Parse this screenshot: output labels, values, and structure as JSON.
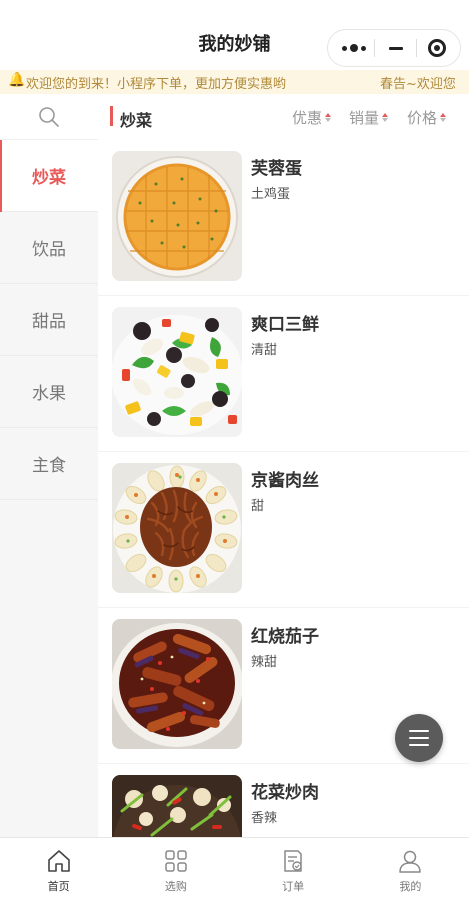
{
  "header": {
    "title": "我的妙铺"
  },
  "notice": {
    "text": "欢迎您的到来！小程序下单，更加方便实惠哟",
    "text2": "春告~欢迎您"
  },
  "sidebar": {
    "items": [
      {
        "label": "炒菜",
        "active": true
      },
      {
        "label": "饮品",
        "active": false
      },
      {
        "label": "甜品",
        "active": false
      },
      {
        "label": "水果",
        "active": false
      },
      {
        "label": "主食",
        "active": false
      }
    ]
  },
  "main": {
    "category": "炒菜",
    "sort": [
      "优惠",
      "销量",
      "价格"
    ],
    "dishes": [
      {
        "name": "芙蓉蛋",
        "desc": "土鸡蛋",
        "icon": "egg-custard-photo"
      },
      {
        "name": "爽口三鲜",
        "desc": "清甜",
        "icon": "stir-fry-vegetables-photo"
      },
      {
        "name": "京酱肉丝",
        "desc": "甜",
        "icon": "shredded-pork-photo"
      },
      {
        "name": "红烧茄子",
        "desc": "辣甜",
        "icon": "braised-eggplant-photo"
      },
      {
        "name": "花菜炒肉",
        "desc": "香辣",
        "icon": "cauliflower-pork-photo"
      }
    ]
  },
  "tabbar": {
    "items": [
      {
        "label": "首页",
        "icon": "home-icon",
        "active": true
      },
      {
        "label": "选购",
        "icon": "grid-icon",
        "active": false
      },
      {
        "label": "订单",
        "icon": "order-icon",
        "active": false
      },
      {
        "label": "我的",
        "icon": "user-icon",
        "active": false
      }
    ]
  },
  "colors": {
    "accent": "#e85a5a",
    "notice_bg": "#fdf6e3"
  }
}
